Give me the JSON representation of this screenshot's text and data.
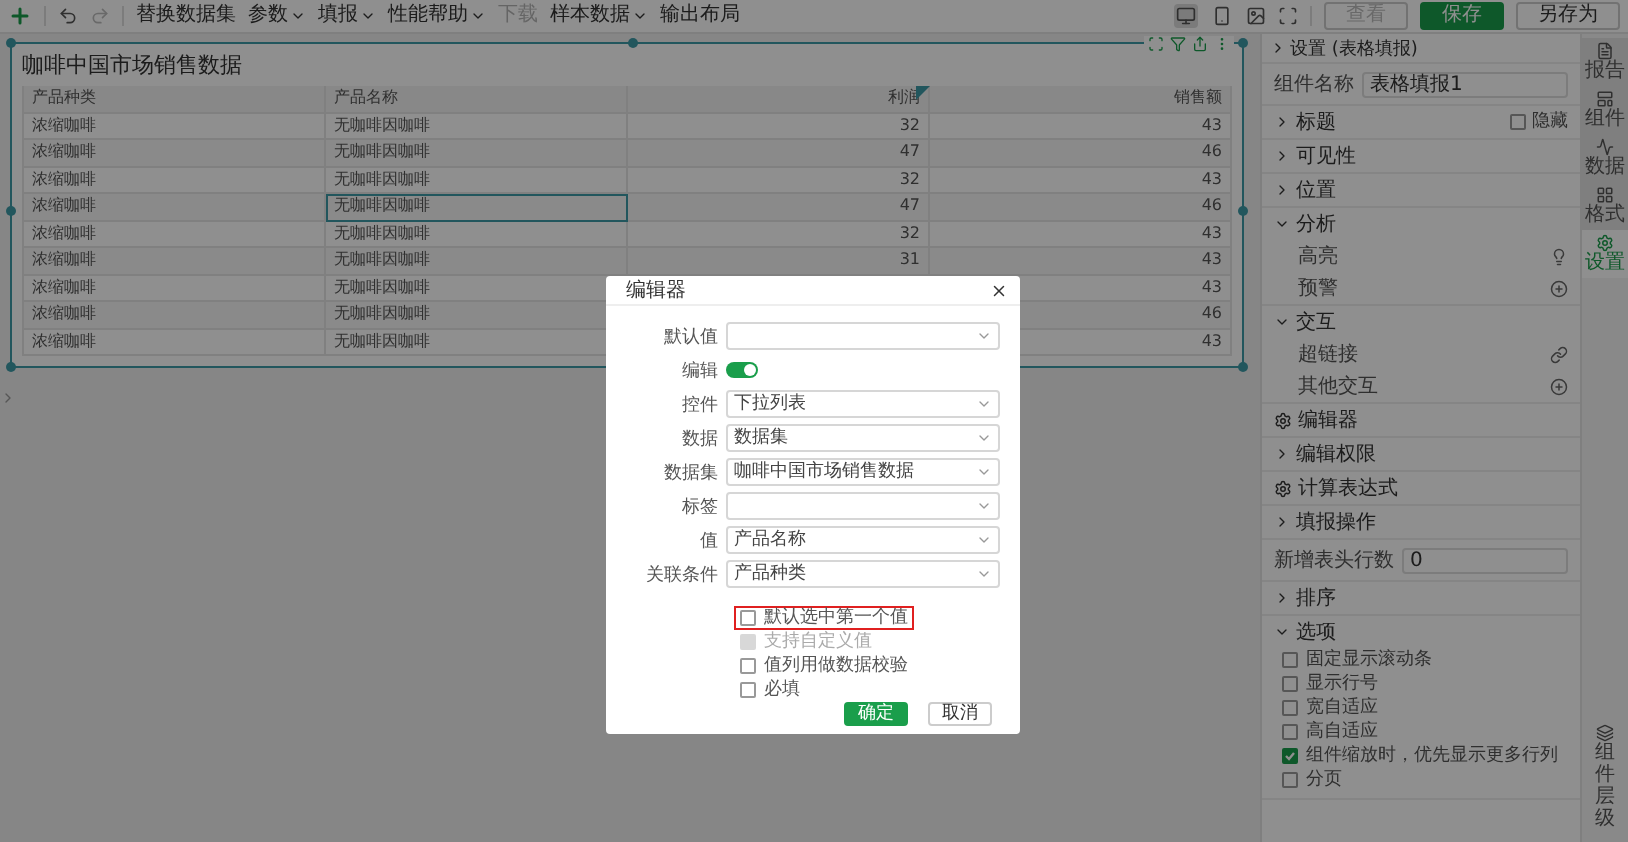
{
  "toolbar": {
    "undo_disabled": false,
    "redo_disabled": true,
    "menu": [
      {
        "label": "替换数据集",
        "dropdown": false,
        "disabled": false
      },
      {
        "label": "参数",
        "dropdown": true,
        "disabled": false
      },
      {
        "label": "填报",
        "dropdown": true,
        "disabled": false
      },
      {
        "label": "性能帮助",
        "dropdown": true,
        "disabled": false
      },
      {
        "label": "下载",
        "dropdown": false,
        "disabled": true
      },
      {
        "label": "样本数据",
        "dropdown": true,
        "disabled": false
      },
      {
        "label": "输出布局",
        "dropdown": false,
        "disabled": false
      }
    ],
    "view_modes": [
      {
        "selected": true
      },
      {
        "selected": false
      }
    ],
    "buttons": [
      {
        "label": "查看",
        "kind": "secondary",
        "disabled": true
      },
      {
        "label": "保存",
        "kind": "primary",
        "disabled": false
      },
      {
        "label": "另存为",
        "kind": "secondary",
        "disabled": false
      }
    ]
  },
  "widget": {
    "title": "咖啡中国市场销售数据",
    "columns": [
      {
        "label": "产品种类",
        "kind": "text"
      },
      {
        "label": "产品名称",
        "kind": "text"
      },
      {
        "label": "利润",
        "kind": "number"
      },
      {
        "label": "销售额",
        "kind": "number"
      }
    ],
    "rows": [
      [
        {
          "text": "浓缩咖啡",
          "selected": false
        },
        {
          "text": "无咖啡因咖啡",
          "selected": false
        },
        {
          "text": "32",
          "selected": false
        },
        {
          "text": "43",
          "selected": false
        }
      ],
      [
        {
          "text": "浓缩咖啡",
          "selected": false
        },
        {
          "text": "无咖啡因咖啡",
          "selected": false
        },
        {
          "text": "47",
          "selected": false
        },
        {
          "text": "46",
          "selected": false
        }
      ],
      [
        {
          "text": "浓缩咖啡",
          "selected": false
        },
        {
          "text": "无咖啡因咖啡",
          "selected": false
        },
        {
          "text": "32",
          "selected": false
        },
        {
          "text": "43",
          "selected": false
        }
      ],
      [
        {
          "text": "浓缩咖啡",
          "selected": false
        },
        {
          "text": "无咖啡因咖啡",
          "selected": true
        },
        {
          "text": "47",
          "selected": false
        },
        {
          "text": "46",
          "selected": false
        }
      ],
      [
        {
          "text": "浓缩咖啡",
          "selected": false
        },
        {
          "text": "无咖啡因咖啡",
          "selected": false
        },
        {
          "text": "32",
          "selected": false
        },
        {
          "text": "43",
          "selected": false
        }
      ],
      [
        {
          "text": "浓缩咖啡",
          "selected": false
        },
        {
          "text": "无咖啡因咖啡",
          "selected": false
        },
        {
          "text": "31",
          "selected": false
        },
        {
          "text": "43",
          "selected": false
        }
      ],
      [
        {
          "text": "浓缩咖啡",
          "selected": false
        },
        {
          "text": "无咖啡因咖啡",
          "selected": false
        },
        null,
        {
          "text": "43",
          "selected": false
        }
      ],
      [
        {
          "text": "浓缩咖啡",
          "selected": false
        },
        {
          "text": "无咖啡因咖啡",
          "selected": false
        },
        null,
        {
          "text": "46",
          "selected": false
        }
      ],
      [
        {
          "text": "浓缩咖啡",
          "selected": false
        },
        {
          "text": "无咖啡因咖啡",
          "selected": false
        },
        null,
        {
          "text": "43",
          "selected": false
        }
      ]
    ]
  },
  "settings": {
    "title": "设置 (表格填报)",
    "name_label": "组件名称",
    "name_value": "表格填报1",
    "sections": [
      {
        "kind": "collapsible",
        "label": "标题",
        "expanded": false,
        "hide_label": "隐藏",
        "hide_checked": false
      },
      {
        "kind": "collapsible",
        "label": "可见性",
        "expanded": false
      },
      {
        "kind": "collapsible",
        "label": "位置",
        "expanded": false
      },
      {
        "kind": "collapsible",
        "label": "分析",
        "expanded": true,
        "items": [
          {
            "label": "高亮",
            "kind": "bulb"
          },
          {
            "label": "预警",
            "kind": "add"
          }
        ]
      },
      {
        "kind": "collapsible",
        "label": "交互",
        "expanded": true,
        "items": [
          {
            "label": "超链接",
            "kind": "link"
          },
          {
            "label": "其他交互",
            "kind": "add"
          }
        ]
      },
      {
        "kind": "gear",
        "label": "编辑器"
      },
      {
        "kind": "collapsible",
        "label": "编辑权限",
        "expanded": false
      },
      {
        "kind": "gear",
        "label": "计算表达式"
      },
      {
        "kind": "collapsible",
        "label": "填报操作",
        "expanded": false
      },
      {
        "kind": "field",
        "label": "新增表头行数",
        "value": "0"
      },
      {
        "kind": "collapsible",
        "label": "排序",
        "expanded": false
      },
      {
        "kind": "collapsible",
        "label": "选项",
        "expanded": true,
        "options": [
          {
            "label": "固定显示滚动条",
            "checked": false
          },
          {
            "label": "显示行号",
            "checked": false
          },
          {
            "label": "宽自适应",
            "checked": false
          },
          {
            "label": "高自适应",
            "checked": false
          },
          {
            "label": "组件缩放时，优先显示更多行列",
            "checked": true
          },
          {
            "label": "分页",
            "checked": false
          }
        ]
      }
    ]
  },
  "side_tabs": [
    {
      "label": "报告",
      "selected": false
    },
    {
      "label": "组件",
      "selected": false
    },
    {
      "label": "数据",
      "selected": false
    },
    {
      "label": "格式",
      "selected": false
    },
    {
      "label": "设置",
      "selected": true
    }
  ],
  "layers_label": "组件层级",
  "dialog": {
    "title": "编辑器",
    "fields": [
      {
        "kind": "select",
        "label": "默认值"
      },
      {
        "kind": "toggle",
        "label": "编辑",
        "on": true
      },
      {
        "kind": "select",
        "label": "控件",
        "value": "下拉列表"
      },
      {
        "kind": "select",
        "label": "数据",
        "value": "数据集"
      },
      {
        "kind": "select",
        "label": "数据集",
        "value": "咖啡中国市场销售数据"
      },
      {
        "kind": "select",
        "label": "标签"
      },
      {
        "kind": "select",
        "label": "值",
        "value": "产品名称"
      },
      {
        "kind": "select",
        "label": "关联条件",
        "value": "产品种类"
      }
    ],
    "options": [
      {
        "label": "默认选中第一个值",
        "checked": false,
        "disabled": false,
        "highlighted": true
      },
      {
        "label": "支持自定义值",
        "checked": false,
        "disabled": true,
        "highlighted": false
      },
      {
        "label": "值列用做数据校验",
        "checked": false,
        "disabled": false,
        "highlighted": false
      },
      {
        "label": "必填",
        "checked": false,
        "disabled": false,
        "highlighted": false
      }
    ],
    "buttons": [
      {
        "label": "确定",
        "kind": "primary"
      },
      {
        "label": "取消",
        "kind": "secondary"
      }
    ]
  }
}
